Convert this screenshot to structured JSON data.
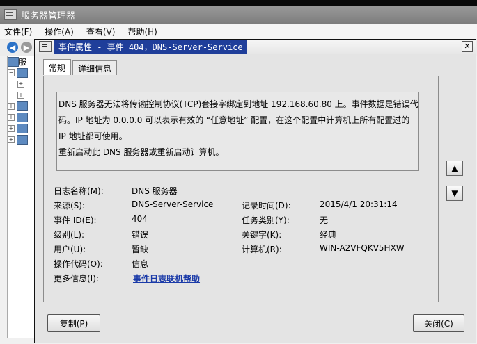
{
  "main_window": {
    "title": "服务器管理器",
    "menu": [
      "文件(F)",
      "操作(A)",
      "查看(V)",
      "帮助(H)"
    ],
    "tree": {
      "root_label": "服"
    }
  },
  "dialog": {
    "title": "事件属性 - 事件 404，DNS-Server-Service",
    "close_glyph": "✕",
    "tabs": [
      {
        "label": "常规",
        "active": true
      },
      {
        "label": "详细信息",
        "active": false
      }
    ],
    "message_lines": [
      "DNS 服务器无法将传输控制协议(TCP)套接字绑定到地址 192.168.60.80 上。事件数据是错误代",
      "码。IP 地址为 0.0.0.0 可以表示有效的 “任意地址” 配置，在这个配置中计算机上所有配置过的",
      "IP 地址都可使用。",
      "重新启动此 DNS 服务器或重新启动计算机。"
    ],
    "fields": {
      "log_name": {
        "label": "日志名称(M):",
        "value": "DNS 服务器"
      },
      "source": {
        "label": "来源(S):",
        "value": "DNS-Server-Service"
      },
      "logged": {
        "label": "记录时间(D):",
        "value": "2015/4/1 20:31:14"
      },
      "event_id": {
        "label": "事件 ID(E):",
        "value": "404"
      },
      "task_category": {
        "label": "任务类别(Y):",
        "value": "无"
      },
      "level": {
        "label": "级别(L):",
        "value": "错误"
      },
      "keywords": {
        "label": "关键字(K):",
        "value": "经典"
      },
      "user": {
        "label": "用户(U):",
        "value": "暂缺"
      },
      "computer": {
        "label": "计算机(R):",
        "value": "WIN-A2VFQKV5HXW"
      },
      "opcode": {
        "label": "操作代码(O):",
        "value": "信息"
      },
      "more_info": {
        "label": "更多信息(I):",
        "value": "事件日志联机帮助"
      }
    },
    "side_buttons": {
      "up_glyph": "▲",
      "down_glyph": "▼"
    },
    "buttons": {
      "copy": "复制(P)",
      "close": "关闭(C)"
    }
  }
}
